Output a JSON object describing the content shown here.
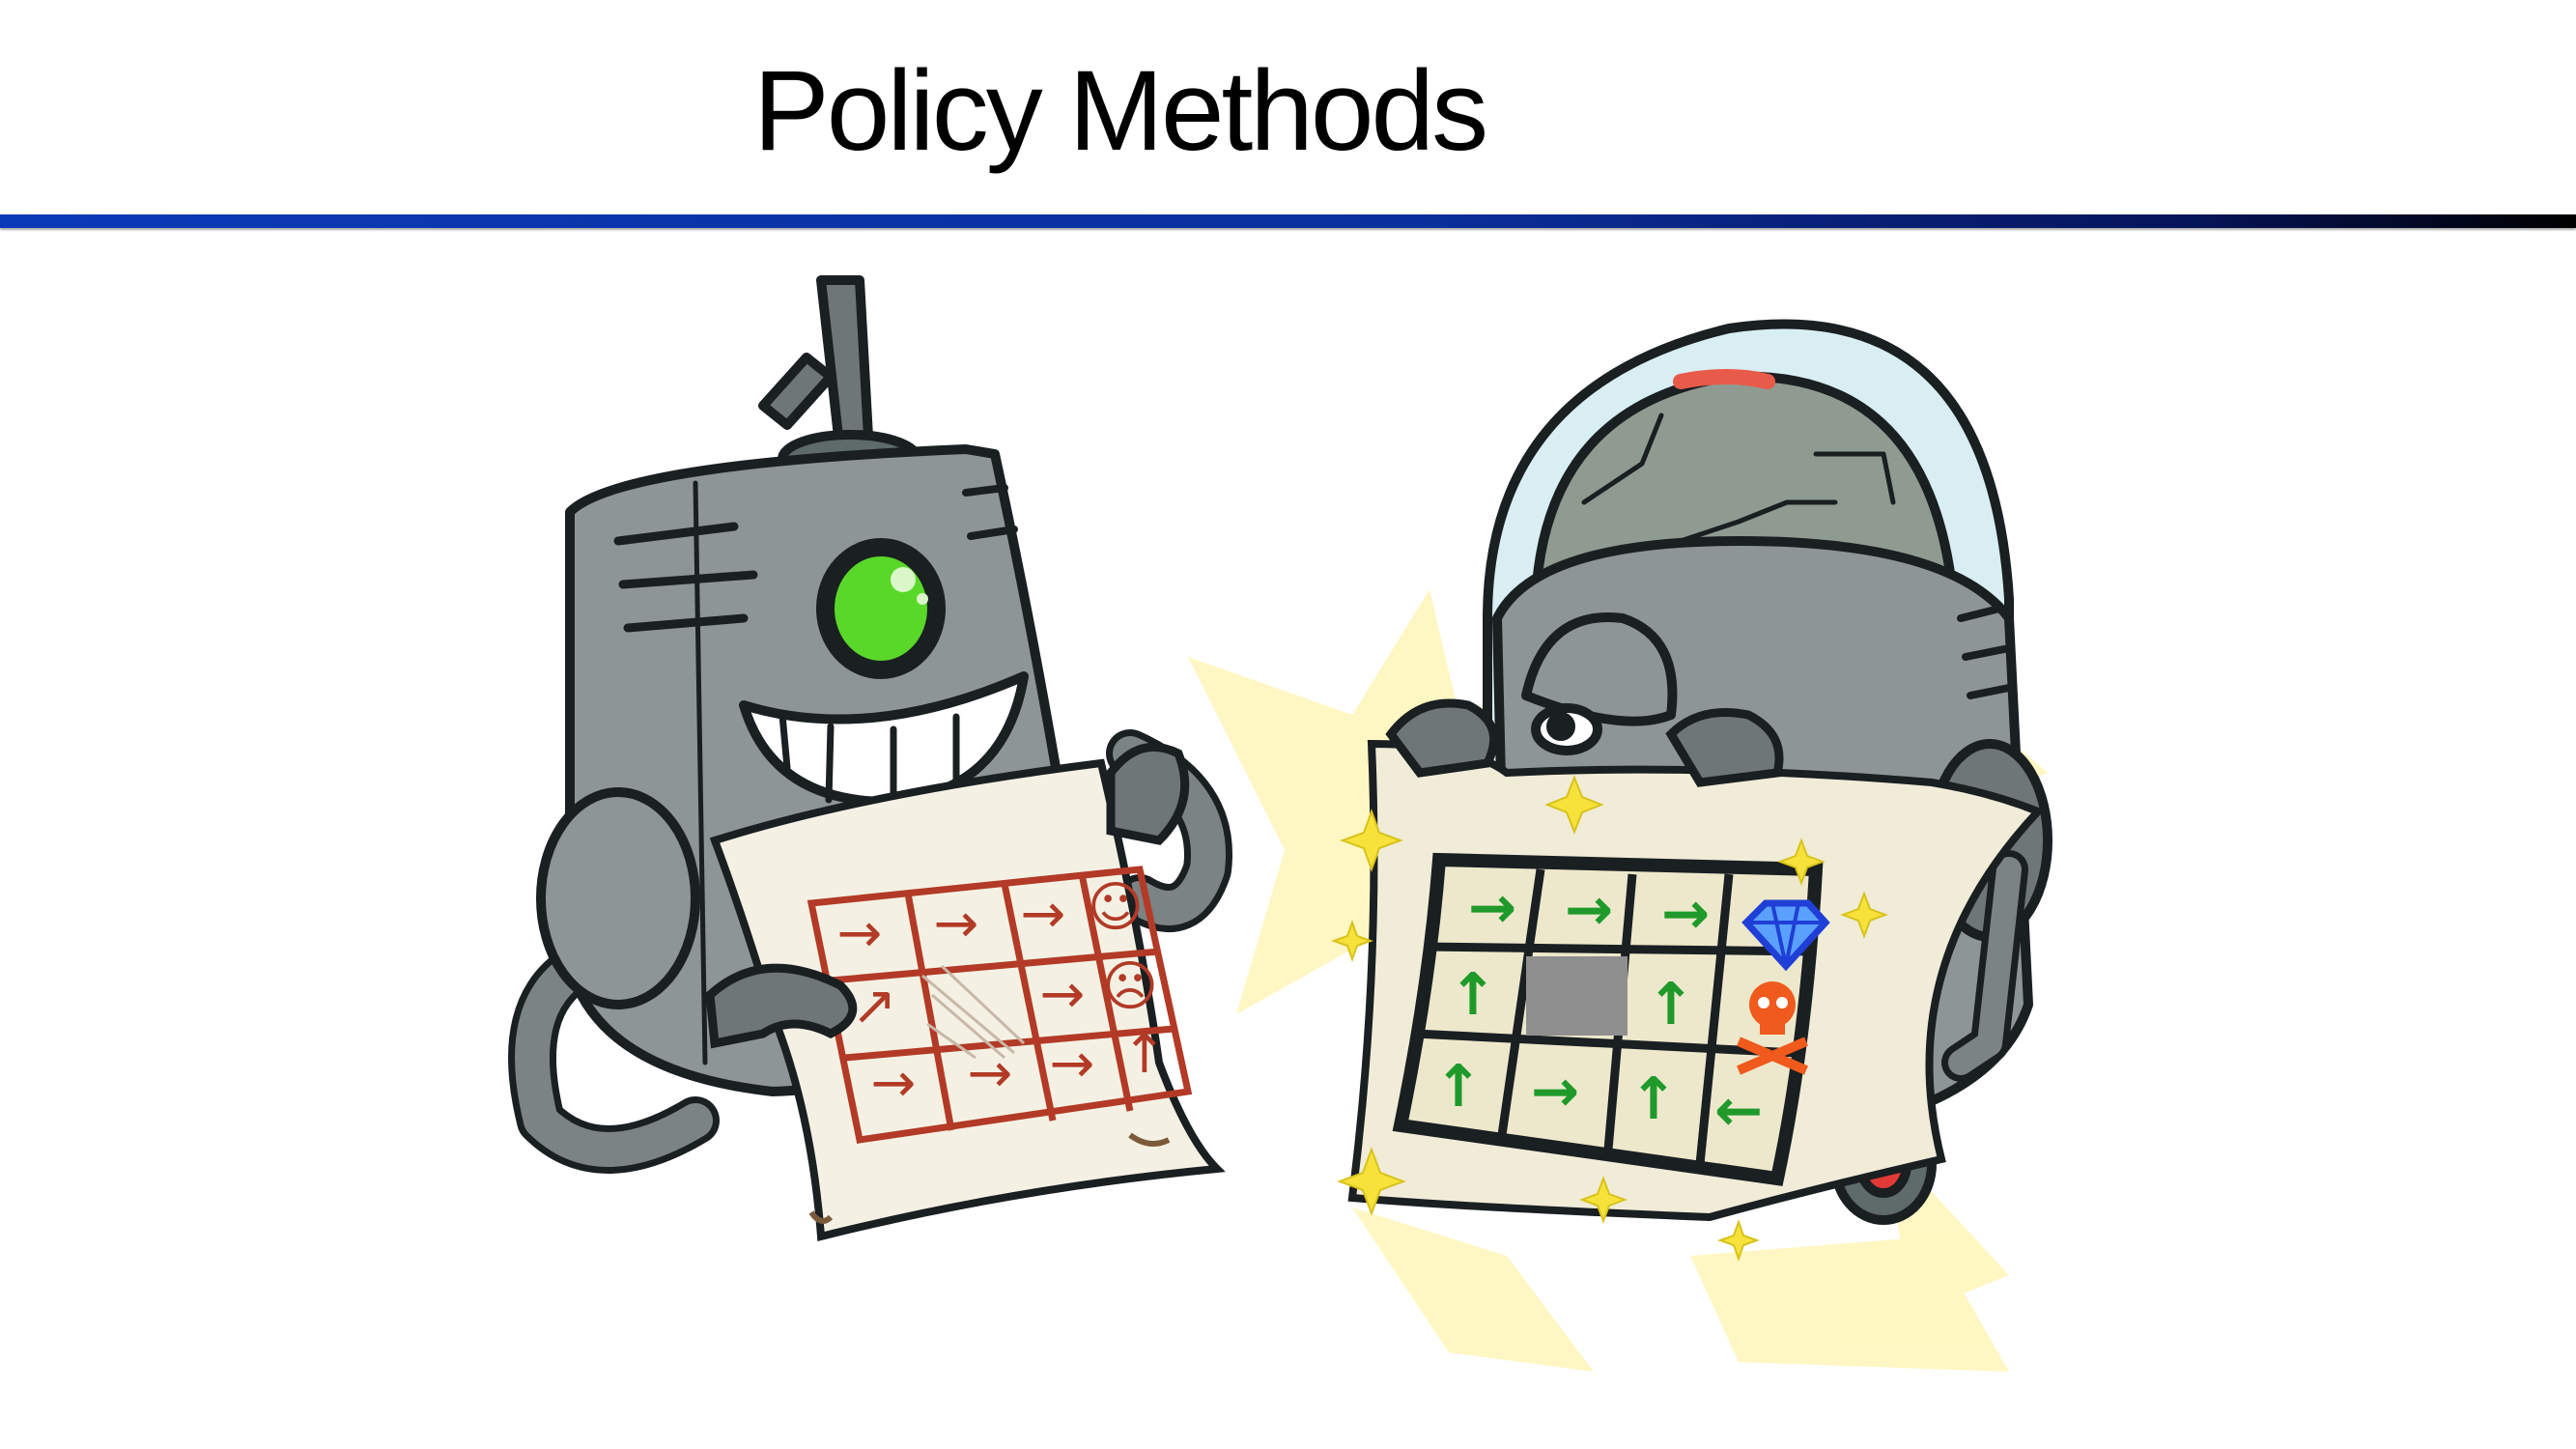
{
  "slide": {
    "title": "Policy Methods"
  },
  "illustration": {
    "left_robot": {
      "eye_color": "#5ad82a",
      "grid_arrow_color": "#b23a26",
      "grid_rows": [
        [
          "→",
          "→",
          "→",
          "☺"
        ],
        [
          "↗",
          "",
          "→",
          "☹"
        ],
        [
          "→",
          "→",
          "→",
          "↑"
        ]
      ]
    },
    "right_robot": {
      "grid_arrow_color": "#1f9a2a",
      "grid_rows": [
        [
          "→",
          "→",
          "→",
          "gem"
        ],
        [
          "↑",
          "wall",
          "↑",
          "skull"
        ],
        [
          "↑",
          "→",
          "↑",
          "←"
        ]
      ],
      "gem_color": "#1f3fd6",
      "skull_color": "#f05a1c"
    },
    "colors": {
      "robot_body": "#8e9596",
      "robot_dark": "#5f6a6b",
      "paper": "#f4f1e4",
      "glow": "#fff3a8",
      "outline": "#1a1f22"
    }
  }
}
